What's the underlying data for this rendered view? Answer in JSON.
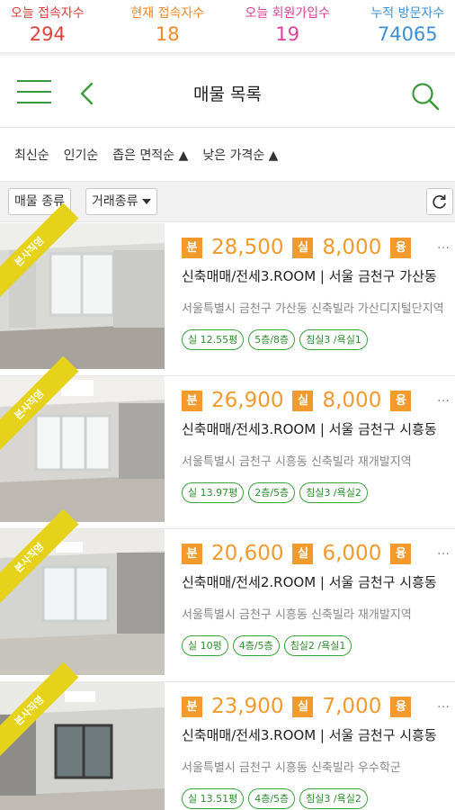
{
  "stats": [
    {
      "label": "오늘 접속자수",
      "value": "294",
      "color": "#e0403a"
    },
    {
      "label": "현재 접속자수",
      "value": "18",
      "color": "#f0892a"
    },
    {
      "label": "오늘 회원가입수",
      "value": "19",
      "color": "#e0409a"
    },
    {
      "label": "누적 방문자수",
      "value": "74065",
      "color": "#3b8fd6"
    }
  ],
  "header": {
    "title": "매물 목록"
  },
  "sorts": [
    "최신순",
    "인기순",
    "좁은 면적순 ▲",
    "낮은 가격순 ▲"
  ],
  "filters": {
    "kind_label": "매물 종류",
    "deal_label": "거래종류"
  },
  "accent": "#3a9a3a",
  "price_color": "#f29a2e",
  "listings": [
    {
      "ribbon": "본사직영",
      "badge1": "분",
      "price1": "28,500",
      "badge2": "실",
      "price2": "8,000",
      "badge3": "융",
      "title": "신축매매/전세3.ROOM | 서울 금천구 가산동",
      "address": "서울특별시 금천구 가산동 신축빌라 가산디지털단지역",
      "tags": [
        "실 12.55평",
        "5층/8층",
        "침실3 /욕실1"
      ]
    },
    {
      "ribbon": "본사직영",
      "badge1": "분",
      "price1": "26,900",
      "badge2": "실",
      "price2": "8,000",
      "badge3": "융",
      "title": "신축매매/전세3.ROOM | 서울 금천구 시흥동",
      "address": "서울특별시 금천구 시흥동 신축빌라 재개발지역",
      "tags": [
        "실 13.97평",
        "2층/5층",
        "침실3 /욕실2"
      ]
    },
    {
      "ribbon": "본사직영",
      "badge1": "분",
      "price1": "20,600",
      "badge2": "실",
      "price2": "6,000",
      "badge3": "융",
      "title": "신축매매/전세2.ROOM | 서울 금천구 시흥동",
      "address": "서울특별시 금천구 시흥동 신축빌라 재개발지역",
      "tags": [
        "실 10평",
        "4층/5층",
        "침실2 /욕실1"
      ]
    },
    {
      "ribbon": "본사직영",
      "badge1": "분",
      "price1": "23,900",
      "badge2": "실",
      "price2": "7,000",
      "badge3": "융",
      "title": "신축매매/전세3.ROOM | 서울 금천구 시흥동",
      "address": "서울특별시 금천구 시흥동 신축빌라 우수학군",
      "tags": [
        "실 13.51평",
        "4층/5층",
        "침실3 /욕실2"
      ]
    }
  ]
}
